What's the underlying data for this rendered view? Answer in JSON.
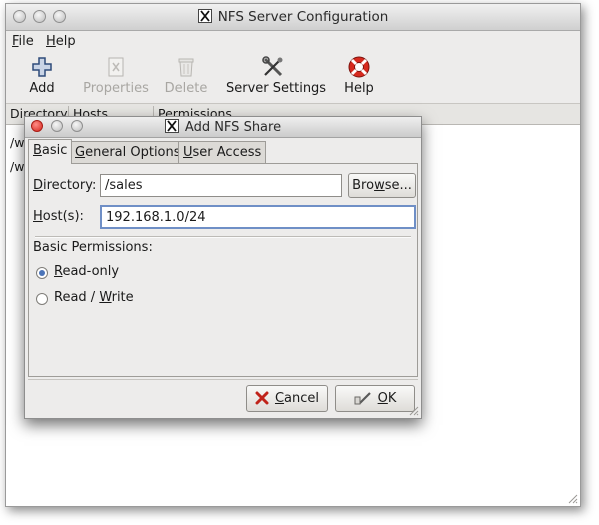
{
  "main_window": {
    "title": "NFS Server Configuration",
    "menu": {
      "file": "File",
      "help": "Help"
    },
    "toolbar": {
      "add": "Add",
      "properties": "Properties",
      "delete": "Delete",
      "server_settings": "Server Settings",
      "help": "Help"
    },
    "list": {
      "columns": [
        "Directory",
        "Hosts",
        "Permissions"
      ],
      "rows": [
        "/w",
        "/w"
      ]
    }
  },
  "dialog": {
    "title": "Add NFS Share",
    "tabs": [
      "Basic",
      "General Options",
      "User Access"
    ],
    "directory": {
      "label": "Directory:",
      "value": "/sales",
      "browse": "Browse..."
    },
    "hosts": {
      "label": "Host(s):",
      "value": "192.168.1.0/24"
    },
    "permissions": {
      "label": "Basic Permissions:",
      "options": [
        "Read-only",
        "Read / Write"
      ],
      "selected": "Read-only"
    },
    "buttons": {
      "cancel": "Cancel",
      "ok": "OK"
    }
  }
}
